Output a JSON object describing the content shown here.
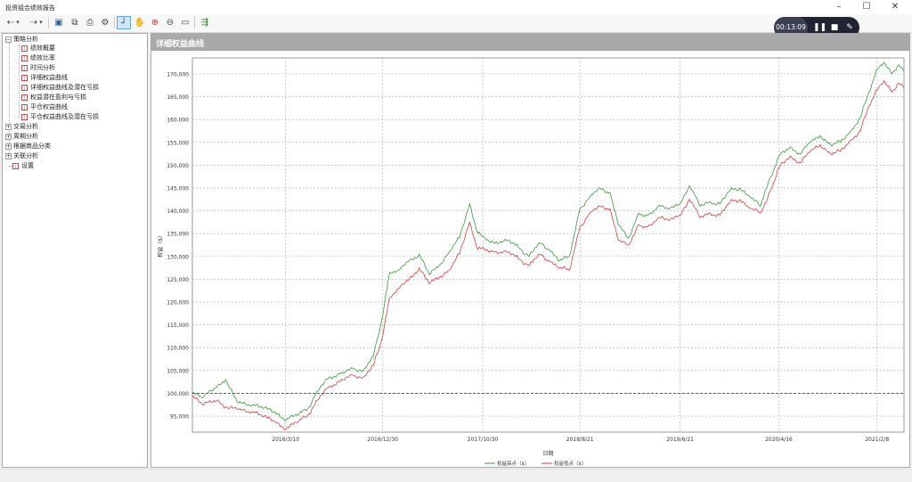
{
  "window": {
    "title": "投资组合绩效报告"
  },
  "toolbar": {
    "icons": [
      "back-icon",
      "dropdown-arrow-icon",
      "forward-icon",
      "dropdown-arrow-icon",
      "save-icon",
      "copy-icon",
      "print-icon",
      "settings-icon",
      "crosshair-icon",
      "pan-hand-icon",
      "zoom-in-icon",
      "zoom-out-icon",
      "zoom-fit-icon",
      "export-icon"
    ]
  },
  "recorder": {
    "time": "00:13:09"
  },
  "tree": {
    "groups": [
      {
        "label": "策略分析",
        "expanded": true,
        "children": [
          "绩效概要",
          "绩效比率",
          "时间分析",
          "详细权益曲线",
          "详细权益曲线及潜在亏损",
          "权益潜在盈利与亏损",
          "平仓权益曲线",
          "平仓权益曲线及潜在亏损"
        ]
      },
      {
        "label": "交易分析",
        "expanded": false
      },
      {
        "label": "周期分析",
        "expanded": false
      },
      {
        "label": "根据商品分类",
        "expanded": false
      },
      {
        "label": "关联分析",
        "expanded": false
      }
    ],
    "settings_label": "设置"
  },
  "panel": {
    "title": "详细权益曲线"
  },
  "chart_data": {
    "type": "line",
    "xlabel": "日期",
    "ylabel": "权益（$）",
    "x_tick_labels": [
      "2016/3/10",
      "2016/12/30",
      "2017/10/30",
      "2018/8/21",
      "2019/6/21",
      "2020/4/16",
      "2021/2/8"
    ],
    "y_tick_labels": [
      "95,000",
      "100,000",
      "105,000",
      "110,000",
      "115,000",
      "120,000",
      "125,000",
      "130,000",
      "135,000",
      "140,000",
      "145,000",
      "150,000",
      "155,000",
      "160,000",
      "165,000",
      "170,000"
    ],
    "xlim": [
      "2015-06-01",
      "2021-05-01"
    ],
    "ylim": [
      91500,
      173500
    ],
    "reference_line": 100000,
    "grid": true,
    "legend_position": "bottom",
    "series": [
      {
        "name": "权益高点（$）",
        "color": "#3a9a3a",
        "points": [
          [
            "2015-06-01",
            100200
          ],
          [
            "2015-07-01",
            99000
          ],
          [
            "2015-08-15",
            101500
          ],
          [
            "2015-09-10",
            103000
          ],
          [
            "2015-10-15",
            98000
          ],
          [
            "2015-12-01",
            97500
          ],
          [
            "2016-01-15",
            96500
          ],
          [
            "2016-02-15",
            95500
          ],
          [
            "2016-03-10",
            94000
          ],
          [
            "2016-04-20",
            95500
          ],
          [
            "2016-05-20",
            97000
          ],
          [
            "2016-06-15",
            100500
          ],
          [
            "2016-07-20",
            103500
          ],
          [
            "2016-09-01",
            104500
          ],
          [
            "2016-10-01",
            105500
          ],
          [
            "2016-11-01",
            105000
          ],
          [
            "2016-12-01",
            108000
          ],
          [
            "2016-12-30",
            117000
          ],
          [
            "2017-01-20",
            126500
          ],
          [
            "2017-02-15",
            127000
          ],
          [
            "2017-03-20",
            129000
          ],
          [
            "2017-04-20",
            130500
          ],
          [
            "2017-05-20",
            126000
          ],
          [
            "2017-06-20",
            128000
          ],
          [
            "2017-07-20",
            131000
          ],
          [
            "2017-08-20",
            134000
          ],
          [
            "2017-09-20",
            141500
          ],
          [
            "2017-10-15",
            135000
          ],
          [
            "2017-10-30",
            134500
          ],
          [
            "2017-12-01",
            133000
          ],
          [
            "2018-01-15",
            133500
          ],
          [
            "2018-02-15",
            132000
          ],
          [
            "2018-03-20",
            130000
          ],
          [
            "2018-04-20",
            133000
          ],
          [
            "2018-05-20",
            131500
          ],
          [
            "2018-06-20",
            129000
          ],
          [
            "2018-07-20",
            130000
          ],
          [
            "2018-08-21",
            140500
          ],
          [
            "2018-09-20",
            143000
          ],
          [
            "2018-10-20",
            145000
          ],
          [
            "2018-11-20",
            144000
          ],
          [
            "2018-12-15",
            137000
          ],
          [
            "2019-01-15",
            134000
          ],
          [
            "2019-02-15",
            139500
          ],
          [
            "2019-03-15",
            139000
          ],
          [
            "2019-04-15",
            141000
          ],
          [
            "2019-05-15",
            140500
          ],
          [
            "2019-06-21",
            141500
          ],
          [
            "2019-07-20",
            145500
          ],
          [
            "2019-08-20",
            141000
          ],
          [
            "2019-09-20",
            142000
          ],
          [
            "2019-10-20",
            141500
          ],
          [
            "2019-11-20",
            144500
          ],
          [
            "2019-12-20",
            145000
          ],
          [
            "2020-01-20",
            143000
          ],
          [
            "2020-02-20",
            141000
          ],
          [
            "2020-03-10",
            145000
          ],
          [
            "2020-04-16",
            152000
          ],
          [
            "2020-05-20",
            154000
          ],
          [
            "2020-06-20",
            152500
          ],
          [
            "2020-07-20",
            155000
          ],
          [
            "2020-08-20",
            156500
          ],
          [
            "2020-09-20",
            154500
          ],
          [
            "2020-10-20",
            155000
          ],
          [
            "2020-11-20",
            157500
          ],
          [
            "2020-12-20",
            160500
          ],
          [
            "2021-01-15",
            166000
          ],
          [
            "2021-02-08",
            171000
          ],
          [
            "2021-03-01",
            172500
          ],
          [
            "2021-03-25",
            170000
          ],
          [
            "2021-04-15",
            172000
          ],
          [
            "2021-05-01",
            170500
          ]
        ]
      },
      {
        "name": "权益低点（$）",
        "color": "#e03a3a",
        "points": [
          [
            "2015-06-01",
            99500
          ],
          [
            "2015-07-01",
            97500
          ],
          [
            "2015-08-15",
            98500
          ],
          [
            "2015-09-10",
            97000
          ],
          [
            "2015-10-15",
            96500
          ],
          [
            "2015-12-01",
            96000
          ],
          [
            "2016-01-15",
            94500
          ],
          [
            "2016-02-15",
            93500
          ],
          [
            "2016-03-10",
            92000
          ],
          [
            "2016-04-20",
            94000
          ],
          [
            "2016-05-20",
            95500
          ],
          [
            "2016-06-15",
            98500
          ],
          [
            "2016-07-20",
            101500
          ],
          [
            "2016-09-01",
            103000
          ],
          [
            "2016-10-01",
            104000
          ],
          [
            "2016-11-01",
            103500
          ],
          [
            "2016-12-01",
            106000
          ],
          [
            "2016-12-30",
            112500
          ],
          [
            "2017-01-20",
            121000
          ],
          [
            "2017-02-15",
            123000
          ],
          [
            "2017-03-20",
            125000
          ],
          [
            "2017-04-20",
            127500
          ],
          [
            "2017-05-20",
            124000
          ],
          [
            "2017-06-20",
            125500
          ],
          [
            "2017-07-20",
            127000
          ],
          [
            "2017-08-20",
            130500
          ],
          [
            "2017-09-20",
            137500
          ],
          [
            "2017-10-15",
            131500
          ],
          [
            "2017-10-30",
            132000
          ],
          [
            "2017-12-01",
            131000
          ],
          [
            "2018-01-15",
            131000
          ],
          [
            "2018-02-15",
            129500
          ],
          [
            "2018-03-20",
            128000
          ],
          [
            "2018-04-20",
            130500
          ],
          [
            "2018-05-20",
            129000
          ],
          [
            "2018-06-20",
            127500
          ],
          [
            "2018-07-20",
            127000
          ],
          [
            "2018-08-21",
            136500
          ],
          [
            "2018-09-20",
            139500
          ],
          [
            "2018-10-20",
            141000
          ],
          [
            "2018-11-20",
            140500
          ],
          [
            "2018-12-15",
            133500
          ],
          [
            "2019-01-15",
            132500
          ],
          [
            "2019-02-15",
            137000
          ],
          [
            "2019-03-15",
            136500
          ],
          [
            "2019-04-15",
            138500
          ],
          [
            "2019-05-15",
            138000
          ],
          [
            "2019-06-21",
            139000
          ],
          [
            "2019-07-20",
            142500
          ],
          [
            "2019-08-20",
            138500
          ],
          [
            "2019-09-20",
            139500
          ],
          [
            "2019-10-20",
            139000
          ],
          [
            "2019-11-20",
            142000
          ],
          [
            "2019-12-20",
            142500
          ],
          [
            "2020-01-20",
            140500
          ],
          [
            "2020-02-20",
            139500
          ],
          [
            "2020-03-10",
            142000
          ],
          [
            "2020-04-16",
            149500
          ],
          [
            "2020-05-20",
            152000
          ],
          [
            "2020-06-20",
            150500
          ],
          [
            "2020-07-20",
            153000
          ],
          [
            "2020-08-20",
            154500
          ],
          [
            "2020-09-20",
            152500
          ],
          [
            "2020-10-20",
            153000
          ],
          [
            "2020-11-20",
            155500
          ],
          [
            "2020-12-20",
            157500
          ],
          [
            "2021-01-15",
            163000
          ],
          [
            "2021-02-08",
            166500
          ],
          [
            "2021-03-01",
            168500
          ],
          [
            "2021-03-25",
            166000
          ],
          [
            "2021-04-15",
            168000
          ],
          [
            "2021-05-01",
            167000
          ]
        ]
      }
    ]
  }
}
